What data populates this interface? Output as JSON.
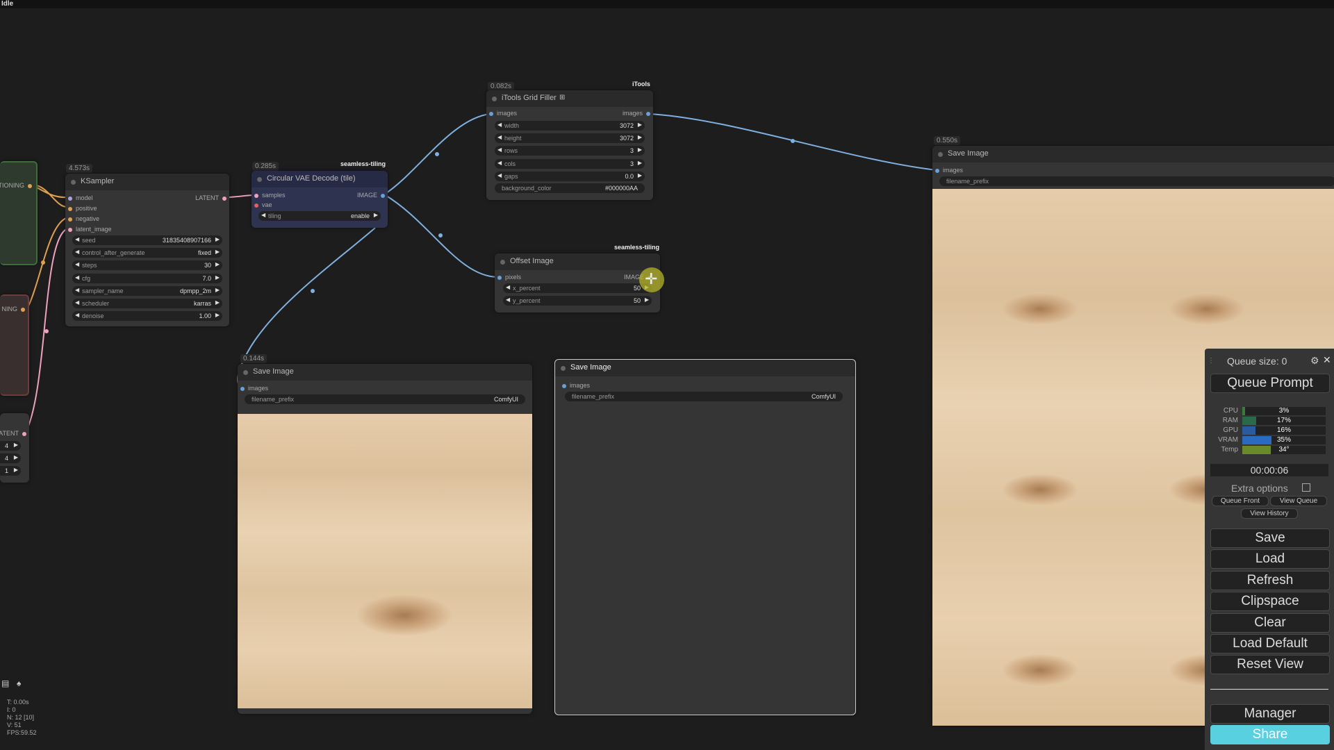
{
  "status": "Idle",
  "ksampler": {
    "time": "4.573s",
    "title": "KSampler",
    "inputs": [
      "model",
      "positive",
      "negative",
      "latent_image"
    ],
    "output": "LATENT",
    "widgets": [
      {
        "label": "seed",
        "value": "318354089071​66"
      },
      {
        "label": "control_after_generate",
        "value": "fixed"
      },
      {
        "label": "steps",
        "value": "30"
      },
      {
        "label": "cfg",
        "value": "7.0"
      },
      {
        "label": "sampler_name",
        "value": "dpmpp_2m"
      },
      {
        "label": "scheduler",
        "value": "karras"
      },
      {
        "label": "denoise",
        "value": "1.00"
      }
    ]
  },
  "vae_decode": {
    "time": "0.285s",
    "group": "seamless-tiling",
    "title": "Circular VAE Decode (tile)",
    "inputs": [
      "samples",
      "vae"
    ],
    "output": "IMAGE",
    "widget": {
      "label": "tiling",
      "value": "enable"
    }
  },
  "grid_filler": {
    "time": "0.082s",
    "group": "iTools",
    "title": "iTools Grid Filler",
    "input": "images",
    "output": "images",
    "widgets": [
      {
        "label": "width",
        "value": "3072"
      },
      {
        "label": "height",
        "value": "3072"
      },
      {
        "label": "rows",
        "value": "3"
      },
      {
        "label": "cols",
        "value": "3"
      },
      {
        "label": "gaps",
        "value": "0.0"
      }
    ],
    "text_widget": {
      "label": "background_color",
      "value": "#000000AA"
    }
  },
  "offset_image": {
    "group": "seamless-tiling",
    "title": "Offset Image",
    "input": "pixels",
    "output": "IMAGE",
    "widgets": [
      {
        "label": "x_percent",
        "value": "50"
      },
      {
        "label": "y_percent",
        "value": "50"
      }
    ]
  },
  "save_left": {
    "time": "0.144s",
    "title": "Save Image",
    "input": "images",
    "prefix_label": "filename_prefix",
    "prefix_value": "ComfyUI"
  },
  "save_middle": {
    "title": "Save Image",
    "input": "images",
    "prefix_label": "filename_prefix",
    "prefix_value": "ComfyUI"
  },
  "save_right": {
    "time": "0.550s",
    "title": "Save Image",
    "input": "images",
    "prefix_label": "filename_prefix"
  },
  "left_partial": {
    "conditioning_1": "TIONING",
    "conditioning_2": "NING",
    "latent": "ATENT",
    "values": [
      "4",
      "4",
      "1"
    ]
  },
  "stats": [
    "T: 0.00s",
    "I: 0",
    "N: 12 [10]",
    "V: 51",
    "FPS:59.52"
  ],
  "queue": {
    "size_label": "Queue size: 0",
    "queue_prompt": "Queue Prompt",
    "monitors": [
      {
        "label": "CPU",
        "value": "3%",
        "fill": 0.03,
        "color": "#3a7a3a"
      },
      {
        "label": "RAM",
        "value": "17%",
        "fill": 0.17,
        "color": "#2a6a4a"
      },
      {
        "label": "GPU",
        "value": "16%",
        "fill": 0.16,
        "color": "#2a5aa0"
      },
      {
        "label": "VRAM",
        "value": "35%",
        "fill": 0.35,
        "color": "#2a6ac0"
      },
      {
        "label": "Temp",
        "value": "34°",
        "fill": 0.34,
        "color": "#6a8a2a"
      }
    ],
    "timer": "00:00:06",
    "extra_options": "Extra options",
    "queue_front": "Queue Front",
    "view_queue": "View Queue",
    "view_history": "View History",
    "buttons": [
      "Save",
      "Load",
      "Refresh",
      "Clipspace",
      "Clear",
      "Load Default",
      "Reset View"
    ],
    "manager": "Manager",
    "share": "Share"
  },
  "colors": {
    "wire_image": "#7fb0de",
    "wire_latent": "#f0a0c0",
    "wire_cond": "#e0a050",
    "share": "#58d0e0"
  }
}
